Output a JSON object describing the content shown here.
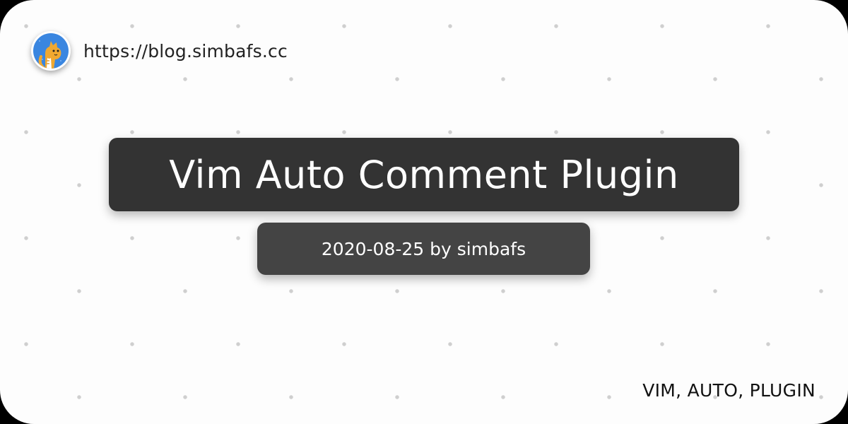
{
  "site": {
    "url": "https://blog.simbafs.cc",
    "avatar_icon": "cat-avatar-icon"
  },
  "post": {
    "title": "Vim Auto Comment Plugin",
    "meta": "2020-08-25 by simbafs",
    "tags": "VIM, AUTO, PLUGIN"
  },
  "colors": {
    "background": "#fdfdfd",
    "title_box": "#333333",
    "meta_box": "#444444",
    "dot": "#cfcfcf",
    "avatar_blue": "#3a86e0",
    "cat_orange": "#f0a830"
  }
}
